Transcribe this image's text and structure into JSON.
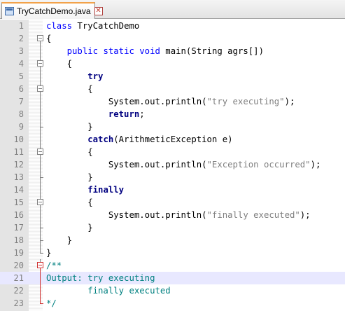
{
  "tab": {
    "title": "TryCatchDemo.java",
    "close_glyph": "✕"
  },
  "lines": [
    {
      "no": "1",
      "tokens": [
        {
          "t": "class",
          "c": "kw"
        },
        {
          "t": " TryCatchDemo",
          "c": ""
        }
      ]
    },
    {
      "no": "2",
      "tokens": [
        {
          "t": "{",
          "c": ""
        }
      ]
    },
    {
      "no": "3",
      "tokens": [
        {
          "t": "    ",
          "c": ""
        },
        {
          "t": "public",
          "c": "kw"
        },
        {
          "t": " ",
          "c": ""
        },
        {
          "t": "static",
          "c": "kw"
        },
        {
          "t": " ",
          "c": ""
        },
        {
          "t": "void",
          "c": "kw"
        },
        {
          "t": " main(String agrs[])",
          "c": ""
        }
      ]
    },
    {
      "no": "4",
      "tokens": [
        {
          "t": "    {",
          "c": ""
        }
      ]
    },
    {
      "no": "5",
      "tokens": [
        {
          "t": "        ",
          "c": ""
        },
        {
          "t": "try",
          "c": "kwb"
        }
      ]
    },
    {
      "no": "6",
      "tokens": [
        {
          "t": "        {",
          "c": ""
        }
      ]
    },
    {
      "no": "7",
      "tokens": [
        {
          "t": "            System.out.println(",
          "c": ""
        },
        {
          "t": "\"try executing\"",
          "c": "str"
        },
        {
          "t": ");",
          "c": ""
        }
      ]
    },
    {
      "no": "8",
      "tokens": [
        {
          "t": "            ",
          "c": ""
        },
        {
          "t": "return",
          "c": "kwb"
        },
        {
          "t": ";",
          "c": ""
        }
      ]
    },
    {
      "no": "9",
      "tokens": [
        {
          "t": "        }",
          "c": ""
        }
      ]
    },
    {
      "no": "10",
      "tokens": [
        {
          "t": "        ",
          "c": ""
        },
        {
          "t": "catch",
          "c": "kwb"
        },
        {
          "t": "(ArithmeticException e)",
          "c": ""
        }
      ]
    },
    {
      "no": "11",
      "tokens": [
        {
          "t": "        {",
          "c": ""
        }
      ]
    },
    {
      "no": "12",
      "tokens": [
        {
          "t": "            System.out.println(",
          "c": ""
        },
        {
          "t": "\"Exception occurred\"",
          "c": "str"
        },
        {
          "t": ");",
          "c": ""
        }
      ]
    },
    {
      "no": "13",
      "tokens": [
        {
          "t": "        }",
          "c": ""
        }
      ]
    },
    {
      "no": "14",
      "tokens": [
        {
          "t": "        ",
          "c": ""
        },
        {
          "t": "finally",
          "c": "kwb"
        }
      ]
    },
    {
      "no": "15",
      "tokens": [
        {
          "t": "        {",
          "c": ""
        }
      ]
    },
    {
      "no": "16",
      "tokens": [
        {
          "t": "            System.out.println(",
          "c": ""
        },
        {
          "t": "\"finally executed\"",
          "c": "str"
        },
        {
          "t": ");",
          "c": ""
        }
      ]
    },
    {
      "no": "17",
      "tokens": [
        {
          "t": "        }",
          "c": ""
        }
      ]
    },
    {
      "no": "18",
      "tokens": [
        {
          "t": "    }",
          "c": ""
        }
      ]
    },
    {
      "no": "19",
      "tokens": [
        {
          "t": "}",
          "c": ""
        }
      ]
    },
    {
      "no": "20",
      "tokens": [
        {
          "t": "/**",
          "c": "cmt"
        }
      ]
    },
    {
      "no": "21",
      "tokens": [
        {
          "t": "Output: try executing",
          "c": "cmt"
        }
      ]
    },
    {
      "no": "22",
      "tokens": [
        {
          "t": "        finally executed",
          "c": "cmt"
        }
      ]
    },
    {
      "no": "23",
      "tokens": [
        {
          "t": "*/",
          "c": "cmt"
        }
      ]
    }
  ],
  "current_line": "21",
  "folds": {
    "2": "open",
    "3": "line",
    "4": "open",
    "5": "line",
    "6": "open",
    "7": "line",
    "8": "line",
    "9": "end",
    "10": "line",
    "11": "open",
    "12": "line",
    "13": "end",
    "14": "line",
    "15": "open",
    "16": "line",
    "17": "end",
    "18": "end",
    "19": "end",
    "20": "open-red",
    "21": "line-red",
    "22": "line-red",
    "23": "end-red"
  },
  "colors": {
    "keyword": "#0000ff",
    "keyword_bold": "#000080",
    "string": "#808080",
    "comment": "#008080",
    "current_line": "#e8e8ff",
    "gutter": "#e4e4e4",
    "tab_accent": "#f2a24a"
  }
}
